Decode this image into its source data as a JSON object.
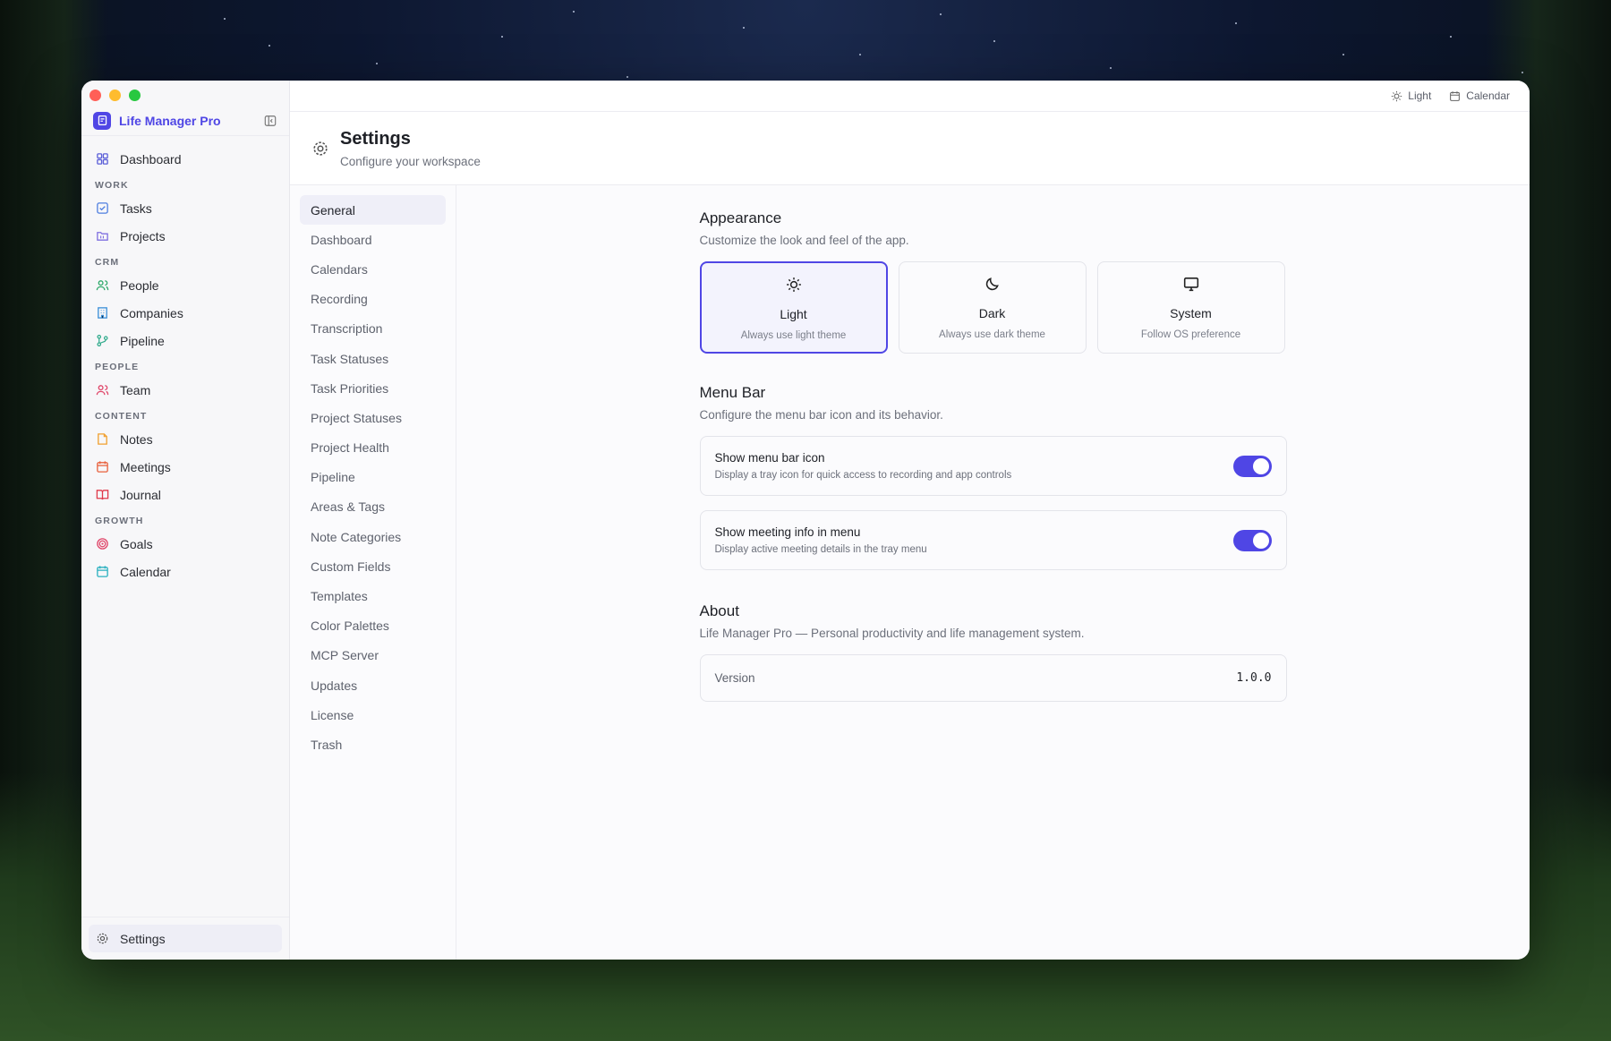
{
  "app": {
    "name": "Life Manager Pro"
  },
  "topbar": {
    "theme_label": "Light",
    "calendar_label": "Calendar"
  },
  "sidebar": {
    "dashboard": "Dashboard",
    "sections": [
      {
        "title": "WORK",
        "items": [
          {
            "label": "Tasks",
            "icon": "checkbox-icon",
            "color": "#4f7fe0"
          },
          {
            "label": "Projects",
            "icon": "folder-icon",
            "color": "#7f6fe0"
          }
        ]
      },
      {
        "title": "CRM",
        "items": [
          {
            "label": "People",
            "icon": "users-icon",
            "color": "#2faa6b"
          },
          {
            "label": "Companies",
            "icon": "building-icon",
            "color": "#3b8fd8"
          },
          {
            "label": "Pipeline",
            "icon": "git-branch-icon",
            "color": "#2faa8b"
          }
        ]
      },
      {
        "title": "PEOPLE",
        "items": [
          {
            "label": "Team",
            "icon": "users-icon",
            "color": "#e0476a"
          }
        ]
      },
      {
        "title": "CONTENT",
        "items": [
          {
            "label": "Notes",
            "icon": "file-icon",
            "color": "#f0a030"
          },
          {
            "label": "Meetings",
            "icon": "calendar-icon",
            "color": "#e8603c"
          },
          {
            "label": "Journal",
            "icon": "book-icon",
            "color": "#e03a4a"
          }
        ]
      },
      {
        "title": "GROWTH",
        "items": [
          {
            "label": "Goals",
            "icon": "target-icon",
            "color": "#e0476a"
          },
          {
            "label": "Calendar",
            "icon": "calendar-icon",
            "color": "#2ab0c0"
          }
        ]
      }
    ],
    "settings": "Settings"
  },
  "header": {
    "title": "Settings",
    "subtitle": "Configure your workspace"
  },
  "settings_nav": {
    "items": [
      "General",
      "Dashboard",
      "Calendars",
      "Recording",
      "Transcription",
      "Task Statuses",
      "Task Priorities",
      "Project Statuses",
      "Project Health",
      "Pipeline",
      "Areas & Tags",
      "Note Categories",
      "Custom Fields",
      "Templates",
      "Color Palettes",
      "MCP Server",
      "Updates",
      "License",
      "Trash"
    ],
    "active": "General"
  },
  "appearance": {
    "title": "Appearance",
    "desc": "Customize the look and feel of the app.",
    "options": [
      {
        "name": "Light",
        "desc": "Always use light theme",
        "selected": true,
        "icon": "sun-icon"
      },
      {
        "name": "Dark",
        "desc": "Always use dark theme",
        "selected": false,
        "icon": "moon-icon"
      },
      {
        "name": "System",
        "desc": "Follow OS preference",
        "selected": false,
        "icon": "monitor-icon"
      }
    ]
  },
  "menubar": {
    "title": "Menu Bar",
    "desc": "Configure the menu bar icon and its behavior.",
    "toggles": [
      {
        "title": "Show menu bar icon",
        "desc": "Display a tray icon for quick access to recording and app controls",
        "on": true
      },
      {
        "title": "Show meeting info in menu",
        "desc": "Display active meeting details in the tray menu",
        "on": true
      }
    ]
  },
  "about": {
    "title": "About",
    "desc": "Life Manager Pro — Personal productivity and life management system.",
    "version_label": "Version",
    "version_value": "1.0.0"
  },
  "colors": {
    "accent": "#4f46e5"
  }
}
